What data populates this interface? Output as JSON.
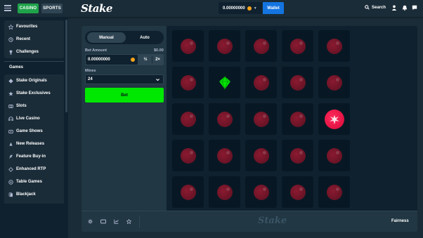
{
  "header": {
    "casino_label": "CASINO",
    "sports_label": "SPORTS",
    "logo_text": "Stake",
    "balance": "0.00000000",
    "wallet_label": "Wallet",
    "search_label": "Search"
  },
  "sidebar": {
    "top_items": [
      {
        "label": "Favourites",
        "icon": "star-icon"
      },
      {
        "label": "Recent",
        "icon": "clock-icon"
      },
      {
        "label": "Challenges",
        "icon": "trophy-icon"
      }
    ],
    "games_heading": "Games",
    "game_items": [
      {
        "label": "Stake Originals",
        "icon": "originals-icon"
      },
      {
        "label": "Stake Exclusives",
        "icon": "exclusives-icon"
      },
      {
        "label": "Slots",
        "icon": "slots-icon"
      },
      {
        "label": "Live Casino",
        "icon": "live-casino-icon"
      },
      {
        "label": "Game Shows",
        "icon": "game-shows-icon"
      },
      {
        "label": "New Releases",
        "icon": "new-releases-icon"
      },
      {
        "label": "Feature Buy-in",
        "icon": "feature-buyin-icon"
      },
      {
        "label": "Enhanced RTP",
        "icon": "enhanced-rtp-icon"
      },
      {
        "label": "Table Games",
        "icon": "table-games-icon"
      },
      {
        "label": "Blackjack",
        "icon": "blackjack-icon"
      }
    ]
  },
  "controls": {
    "manual_label": "Manual",
    "auto_label": "Auto",
    "bet_amount_label": "Bet Amount",
    "bet_amount_usd": "$0.00",
    "bet_amount_value": "0.00000000",
    "half_label": "½",
    "double_label": "2×",
    "mines_label": "Mines",
    "mines_value": "24",
    "bet_button_label": "Bet"
  },
  "board": {
    "rows": 5,
    "cols": 5,
    "gem_position": [
      1,
      1
    ],
    "hit_mine_position": [
      2,
      4
    ],
    "colors": {
      "gem": "#00e701",
      "mine": "#8a1a30",
      "hit_mine": "#ff2a5a"
    }
  },
  "footer": {
    "logo_text": "Stake",
    "fairness_label": "Fairness"
  },
  "colors": {
    "accent_green": "#00e701",
    "casino_green": "#1fa34a",
    "wallet_blue": "#1475e1",
    "background": "#1a2c38",
    "panel": "#213743"
  }
}
